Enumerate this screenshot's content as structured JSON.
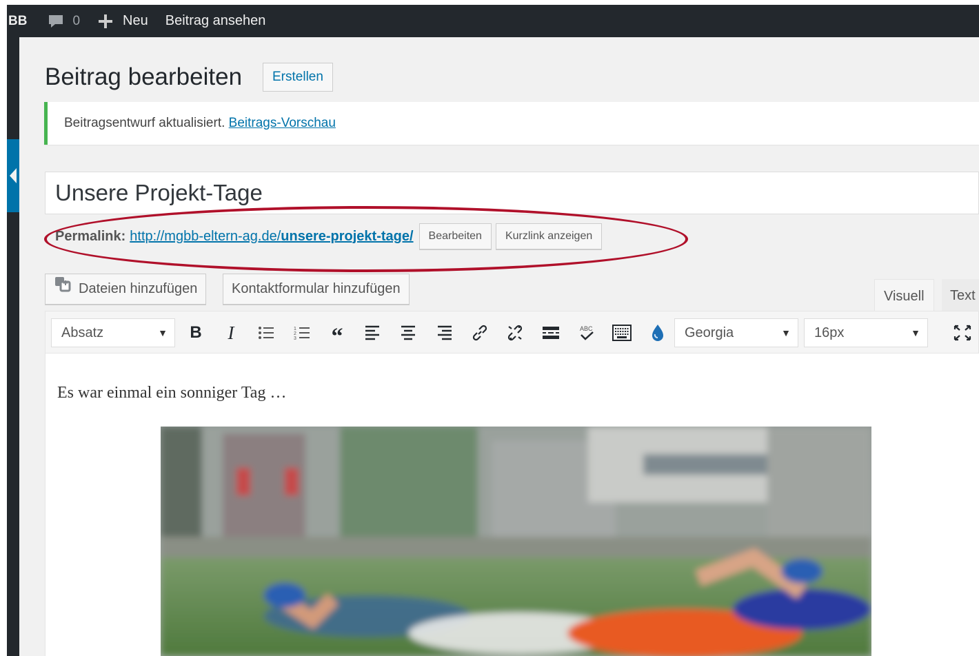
{
  "admin_bar": {
    "site_name": "BB",
    "comments_count": "0",
    "new_label": "Neu",
    "view_post_label": "Beitrag ansehen"
  },
  "page": {
    "title": "Beitrag bearbeiten",
    "create_button": "Erstellen"
  },
  "notice": {
    "message": "Beitragsentwurf aktualisiert.",
    "preview_link": "Beitrags-Vorschau",
    "accent_color": "#46b450"
  },
  "post": {
    "title": "Unsere Projekt-Tage"
  },
  "permalink": {
    "label": "Permalink:",
    "url_base": "http://mgbb-eltern-ag.de/",
    "url_slug": "unsere-projekt-tage/",
    "edit_button": "Bearbeiten",
    "shortlink_button": "Kurzlink anzeigen",
    "highlight_color": "#b0102a"
  },
  "media_buttons": {
    "add_files": "Dateien hinzufügen",
    "contact_form": "Kontaktformular hinzufügen"
  },
  "editor_tabs": {
    "visual": "Visuell",
    "text": "Text"
  },
  "toolbar": {
    "format_select": "Absatz",
    "font_family_select": "Georgia",
    "font_size_select": "16px",
    "icons": [
      "bold-icon",
      "italic-icon",
      "bulleted-list-icon",
      "numbered-list-icon",
      "blockquote-icon",
      "align-left-icon",
      "align-center-icon",
      "align-right-icon",
      "insert-link-icon",
      "remove-link-icon",
      "read-more-icon",
      "spellcheck-icon",
      "toolbar-toggle-icon",
      "drop-icon",
      "fullscreen-icon"
    ]
  },
  "editor": {
    "paragraph": "Es war einmal ein sonniger Tag …",
    "image_description": "photo"
  }
}
